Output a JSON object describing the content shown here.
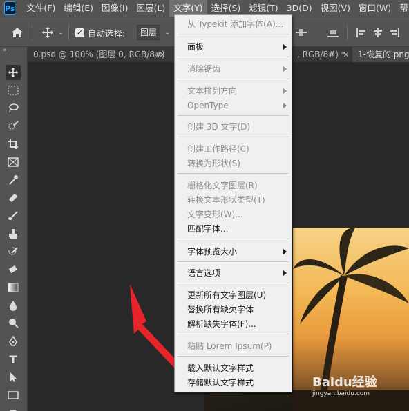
{
  "menubar": {
    "logo": "Ps",
    "items": [
      "文件(F)",
      "编辑(E)",
      "图像(I)",
      "图层(L)",
      "文字(Y)",
      "选择(S)",
      "滤镜(T)",
      "3D(D)",
      "视图(V)",
      "窗口(W)",
      "帮"
    ]
  },
  "options": {
    "auto_select_label": "自动选择:",
    "auto_select_value": "图层"
  },
  "tabs": [
    {
      "label": "0.psd @ 100% (图层 0, RGB/8#)",
      "close": "×"
    },
    {
      "label": ", RGB/8#) *",
      "close": "×"
    },
    {
      "label": "1-恢复的.png"
    }
  ],
  "text_menu": {
    "items": [
      {
        "label": "从 Typekit 添加字体(A)...",
        "enabled": false
      },
      {
        "label": "面板",
        "enabled": true,
        "submenu": true
      },
      {
        "label": "消除锯齿",
        "enabled": false,
        "submenu": true
      },
      {
        "label": "文本排列方向",
        "enabled": false,
        "submenu": true
      },
      {
        "label": "OpenType",
        "enabled": false,
        "submenu": true
      },
      {
        "label": "创建 3D 文字(D)",
        "enabled": false
      },
      {
        "label": "创建工作路径(C)",
        "enabled": false
      },
      {
        "label": "转换为形状(S)",
        "enabled": false
      },
      {
        "label": "栅格化文字图层(R)",
        "enabled": false
      },
      {
        "label": "转换文本形状类型(T)",
        "enabled": false
      },
      {
        "label": "文字变形(W)...",
        "enabled": false
      },
      {
        "label": "匹配字体...",
        "enabled": true
      },
      {
        "label": "字体预览大小",
        "enabled": true,
        "submenu": true
      },
      {
        "label": "语言选项",
        "enabled": true,
        "submenu": true
      },
      {
        "label": "更新所有文字图层(U)",
        "enabled": true
      },
      {
        "label": "替换所有缺欠字体",
        "enabled": true
      },
      {
        "label": "解析缺失字体(F)...",
        "enabled": true
      },
      {
        "label": "粘贴 Lorem Ipsum(P)",
        "enabled": false
      },
      {
        "label": "载入默认文字样式",
        "enabled": true
      },
      {
        "label": "存储默认文字样式",
        "enabled": true
      }
    ]
  },
  "watermark": {
    "brand": "Baidu经验",
    "url": "jingyan.baidu.com"
  },
  "colors": {
    "ui_dark": "#535353",
    "canvas": "#282828",
    "menu_bg": "#f0f0f0",
    "arrow_red": "#e8242b",
    "ps_blue": "#31a8ff"
  }
}
